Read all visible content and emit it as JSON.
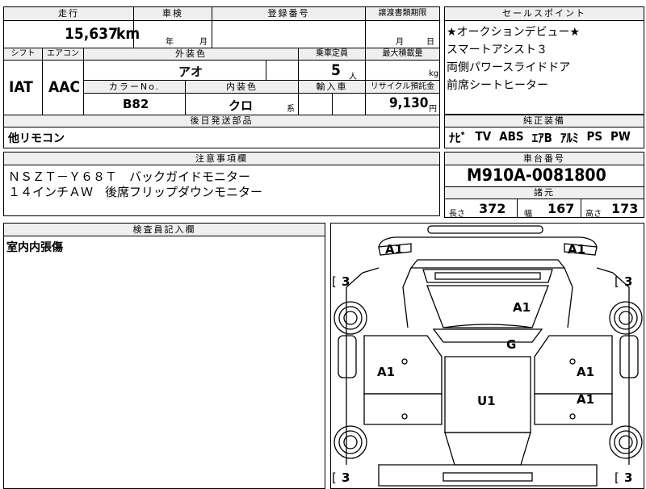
{
  "main": {
    "mileage_header": "走行",
    "mileage_value": "15,637",
    "mileage_unit": "km",
    "inspection_header": "車検",
    "inspection_year_label": "年",
    "inspection_month_label": "月",
    "registration_header": "登録番号",
    "transfer_header": "譲渡書類期限",
    "transfer_month_label": "月",
    "transfer_day_label": "日",
    "shift_header": "シフト",
    "shift_value": "IAT",
    "ac_header": "エアコン",
    "ac_value": "AAC",
    "exterior_color_header": "外装色",
    "exterior_color_value": "アオ",
    "capacity_header": "乗車定員",
    "capacity_value": "5",
    "capacity_unit": "人",
    "max_load_header": "最大積載量",
    "max_load_unit": "kg",
    "color_no_header": "カラーNo.",
    "color_no_value": "B82",
    "interior_color_header": "内装色",
    "interior_color_value": "クロ",
    "interior_color_suffix": "系",
    "import_header": "輸入車",
    "recycle_header": "リサイクル預託金",
    "recycle_value": "9,130",
    "recycle_unit": "円",
    "shipping_parts_header": "後日発送部品",
    "shipping_parts_value": "他リモコン"
  },
  "selling_points": {
    "header": "セールスポイント",
    "items": [
      "★オークションデビュー★",
      "スマートアシスト３",
      "両側パワースライドドア",
      "前席シートヒーター"
    ]
  },
  "equipment": {
    "header": "純正装備",
    "items": [
      "ﾅﾋﾞ",
      "TV",
      "ABS",
      "ｴｱB",
      "ｱﾙﾐ",
      "PS",
      "PW"
    ]
  },
  "notes": {
    "header": "注意事項欄",
    "lines": [
      "ＮＳＺＴ－Ｙ６８Ｔ　バックガイドモニター",
      "１４インチＡＷ　後席フリップダウンモニター"
    ]
  },
  "chassis": {
    "header": "車台番号",
    "value": "M910A-0081800"
  },
  "dimensions": {
    "header": "諸元",
    "length_label": "長さ",
    "length_value": "372",
    "width_label": "幅",
    "width_value": "167",
    "height_label": "高さ",
    "height_value": "173"
  },
  "inspector": {
    "header": "検査員記入欄",
    "comment": "室内内張傷"
  },
  "diagram": {
    "marks": {
      "front_left": "A1",
      "front_right": "A1",
      "hood": "A1",
      "windshield": "G",
      "left_front_door": "A1",
      "right_front_door": "A1",
      "right_rear_door": "A1",
      "roof": "U1"
    },
    "tires": {
      "front_left": "3",
      "front_right": "3",
      "rear_left": "3",
      "rear_right": "3"
    }
  }
}
